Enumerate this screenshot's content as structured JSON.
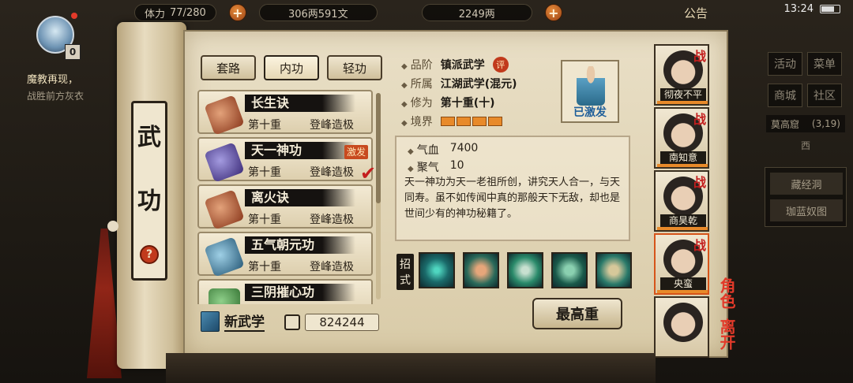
{
  "topbar": {
    "stamina_label": "体力",
    "stamina": "77/280",
    "money": "306两591文",
    "gold": "2249两",
    "announcement": "公告",
    "clock": "13:24"
  },
  "player": {
    "level": "0"
  },
  "quest": {
    "title": "魔教再现，",
    "desc": "战胜前方灰衣"
  },
  "scroll": {
    "char1": "武",
    "char2": "功",
    "help": "?"
  },
  "tabs": [
    {
      "label": "套路"
    },
    {
      "label": "内功"
    },
    {
      "label": "轻功"
    }
  ],
  "skills": [
    {
      "name": "长生诀",
      "level": "第十重",
      "stage": "登峰造极",
      "tag": ""
    },
    {
      "name": "天一神功",
      "level": "第十重",
      "stage": "登峰造极",
      "tag": "激发"
    },
    {
      "name": "离火诀",
      "level": "第十重",
      "stage": "登峰造极",
      "tag": ""
    },
    {
      "name": "五气朝元功",
      "level": "第十重",
      "stage": "登峰造极",
      "tag": ""
    },
    {
      "name": "三阴摧心功",
      "level": "",
      "stage": "",
      "tag": ""
    }
  ],
  "footer": {
    "new_skill": "新武学",
    "exp": "824244"
  },
  "detail": {
    "grade_label": "品阶",
    "grade": "镇派武学",
    "eval": "评",
    "belong_label": "所属",
    "belong": "江湖武学(混元)",
    "cultivation_label": "修为",
    "cultivation": "第十重(十)",
    "realm_label": "境界",
    "activated": "已激发",
    "hp_label": "气血",
    "hp": "7400",
    "qi_label": "聚气",
    "qi": "10",
    "description": "天一神功为天一老祖所创，讲究天人合一，与天同寿。虽不如传闻中真的那般天下无敌，却也是世间少有的神功秘籍了。",
    "moves_label_1": "招",
    "moves_label_2": "式",
    "max_button": "最高重"
  },
  "characters": [
    {
      "name": "彻夜不平",
      "mark": "战"
    },
    {
      "name": "南知意",
      "mark": "战"
    },
    {
      "name": "商昊乾",
      "mark": "战"
    },
    {
      "name": "央蛮",
      "mark": "战"
    },
    {
      "name": "",
      "mark": ""
    }
  ],
  "side_labels": {
    "role": "角色",
    "leave": "离开"
  },
  "right_menu": {
    "b1": "活动",
    "b2": "菜单",
    "b3": "商城",
    "b4": "社区",
    "location": "莫高窟",
    "coords": "(3,19)",
    "compass": "西",
    "tool1": "藏经洞",
    "tool2": "珈蓝奴图"
  }
}
